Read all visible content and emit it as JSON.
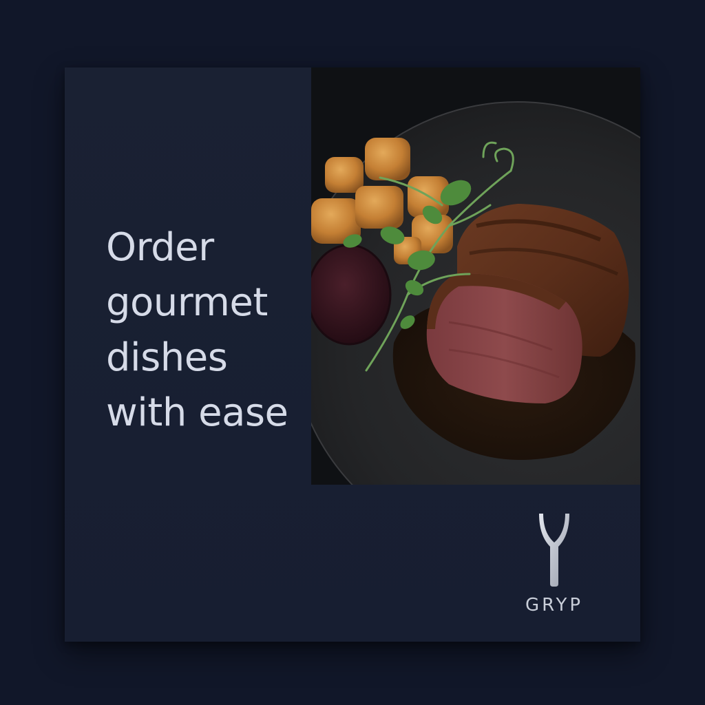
{
  "headline": {
    "lines": [
      "Order",
      "gourmet",
      "dishes",
      "with ease"
    ]
  },
  "brand": {
    "name": "GRYP",
    "icon": "fork-y-icon"
  },
  "photo": {
    "subject": "steak-dish-icon"
  },
  "colors": {
    "page_background": "#111729",
    "card_background": "#1a2133",
    "text": "#d6dbe8",
    "brand_text": "#c9ced9"
  }
}
